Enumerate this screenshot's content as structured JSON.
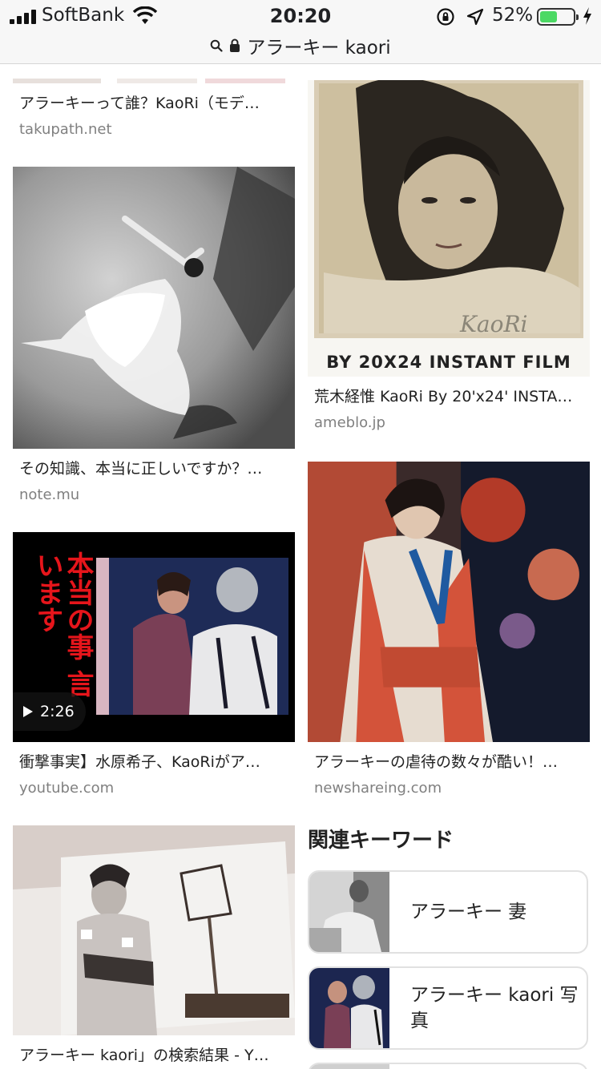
{
  "status_bar": {
    "carrier": "SoftBank",
    "time": "20:20",
    "battery_percent_label": "52%",
    "battery_level": 0.52,
    "icons": [
      "signal-icon",
      "wifi-icon",
      "rotation-lock-icon",
      "location-icon",
      "battery-icon",
      "charging-icon"
    ]
  },
  "url_bar": {
    "query": "アラーキー kaori",
    "icons": [
      "search-icon",
      "lock-icon"
    ]
  },
  "results": {
    "left": [
      {
        "caption": "アラーキーって誰？KaoRi（モデ…",
        "source": "takupath.net"
      },
      {
        "caption": "その知識、本当に正しいですか？…",
        "source": "note.mu"
      },
      {
        "caption": "衝撃事実】水原希子、KaoRiがア…",
        "source": "youtube.com",
        "duration": "2:26",
        "overlay_text": "本当の事 言います"
      },
      {
        "caption": "アラーキー kaori」の検索結果 - Y…",
        "source": ""
      }
    ],
    "right": [
      {
        "caption": "荒木経惟 KaoRi By 20'x24' INSTA…",
        "source": "ameblo.jp",
        "banner": "BY 20X24 INSTANT FILM",
        "signature": "KaoRi"
      },
      {
        "caption": "アラーキーの虐待の数々が酷い！…",
        "source": "newshareing.com"
      }
    ]
  },
  "related": {
    "title": "関連キーワード",
    "items": [
      {
        "label": "アラーキー 妻"
      },
      {
        "label": "アラーキー kaori 写真"
      }
    ]
  },
  "colors": {
    "topbar_bg": "#f7f7f7",
    "battery_green": "#4cd964",
    "source_gray": "#808080"
  }
}
